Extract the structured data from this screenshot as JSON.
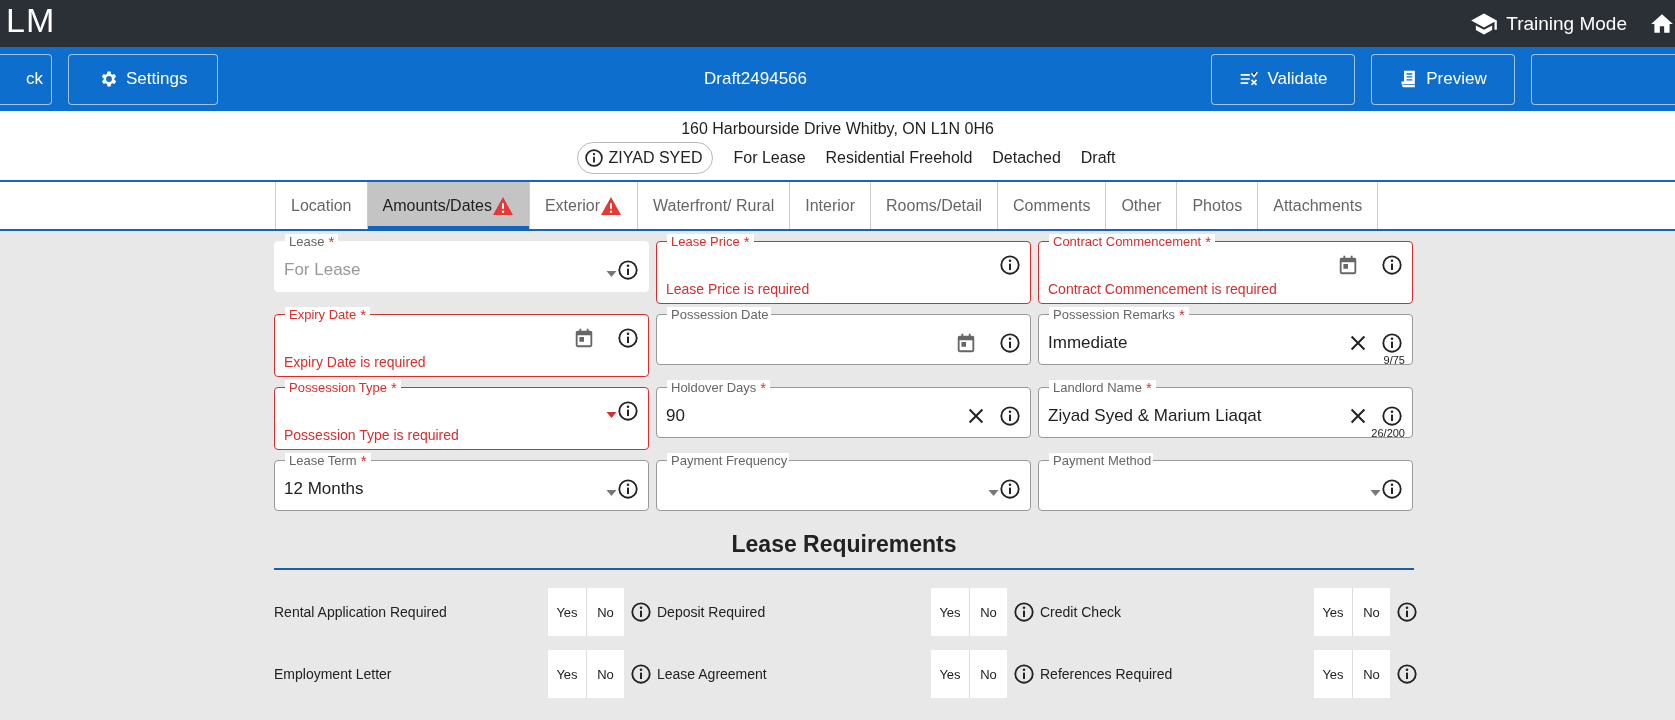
{
  "app_bar": {
    "logo": "LM",
    "training_mode": "Training Mode"
  },
  "toolbar": {
    "left_buttons": [
      "ck",
      "Settings"
    ],
    "title": "Draft2494566",
    "right_buttons": [
      "Validate",
      "Preview"
    ]
  },
  "header": {
    "address": "160 Harbourside Drive Whitby, ON L1N 0H6",
    "agent": "ZIYAD SYED",
    "tags": [
      "For Lease",
      "Residential Freehold",
      "Detached",
      "Draft"
    ]
  },
  "tabs": [
    {
      "label": "Location",
      "selected": false,
      "warning": false
    },
    {
      "label": "Amounts/Dates",
      "selected": true,
      "warning": true
    },
    {
      "label": "Exterior",
      "selected": false,
      "warning": true
    },
    {
      "label": "Waterfront/ Rural",
      "selected": false,
      "warning": false
    },
    {
      "label": "Interior",
      "selected": false,
      "warning": false
    },
    {
      "label": "Rooms/Detail",
      "selected": false,
      "warning": false
    },
    {
      "label": "Comments",
      "selected": false,
      "warning": false
    },
    {
      "label": "Other",
      "selected": false,
      "warning": false
    },
    {
      "label": "Photos",
      "selected": false,
      "warning": false
    },
    {
      "label": "Attachments",
      "selected": false,
      "warning": false
    }
  ],
  "fields": [
    {
      "kind": "select",
      "label": "Lease",
      "required_mark": "*",
      "value": "For Lease",
      "disabled": true,
      "clearable": false
    },
    {
      "kind": "text",
      "label": "Lease Price",
      "required_mark": "*",
      "error": "Lease Price is required",
      "disabled": false,
      "clearable": false
    },
    {
      "kind": "date",
      "label": "Contract Commencement",
      "required_mark": "*",
      "error": "Contract Commencement is required",
      "disabled": false,
      "clearable": false
    },
    {
      "kind": "date",
      "label": "Expiry Date",
      "required_mark": "*",
      "error": "Expiry Date is required",
      "disabled": false,
      "clearable": false
    },
    {
      "kind": "date",
      "label": "Possession Date",
      "disabled": false,
      "clearable": false
    },
    {
      "kind": "text",
      "label": "Possession Remarks",
      "required_mark": "*",
      "value": "Immediate",
      "clearable": true,
      "counter": "9/75",
      "disabled": false
    },
    {
      "kind": "select",
      "label": "Possession Type",
      "required_mark": "*",
      "error": "Possession Type is required",
      "disabled": false,
      "clearable": false
    },
    {
      "kind": "text",
      "label": "Holdover Days",
      "required_mark": "*",
      "value": "90",
      "clearable": true,
      "disabled": false
    },
    {
      "kind": "text",
      "label": "Landlord Name",
      "required_mark": "*",
      "value": "Ziyad Syed & Marium Liaqat",
      "clearable": true,
      "counter": "26/200",
      "disabled": false
    },
    {
      "kind": "select",
      "label": "Lease Term",
      "required_mark": "*",
      "value": "12 Months",
      "disabled": false,
      "clearable": false
    },
    {
      "kind": "select",
      "label": "Payment Frequency",
      "disabled": false,
      "clearable": false
    },
    {
      "kind": "select",
      "label": "Payment Method",
      "disabled": false,
      "clearable": false
    }
  ],
  "section_title": "Lease Requirements",
  "requirements": [
    {
      "label": "Rental Application Required",
      "yes": "Yes",
      "no": "No"
    },
    {
      "label": "Deposit Required",
      "yes": "Yes",
      "no": "No"
    },
    {
      "label": "Credit Check",
      "yes": "Yes",
      "no": "No"
    },
    {
      "label": "Employment Letter",
      "yes": "Yes",
      "no": "No"
    },
    {
      "label": "Lease Agreement",
      "yes": "Yes",
      "no": "No"
    },
    {
      "label": "References Required",
      "yes": "Yes",
      "no": "No"
    }
  ]
}
